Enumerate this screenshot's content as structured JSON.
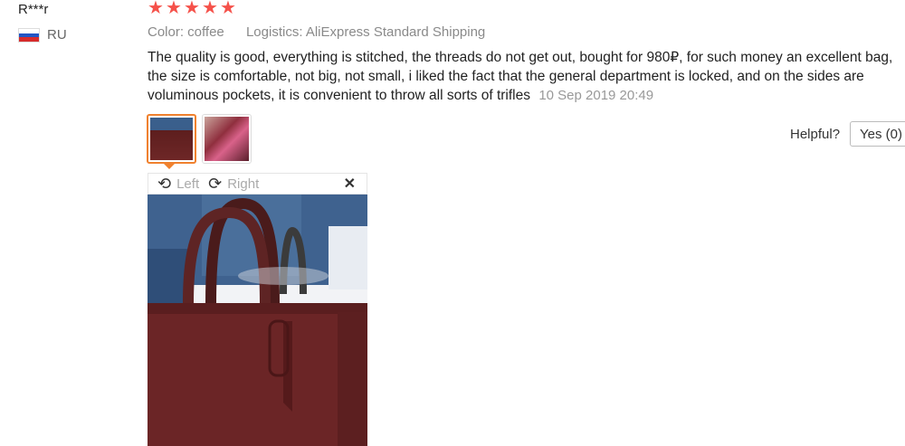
{
  "reviewer": {
    "name": "R***r",
    "country": "RU",
    "flag_icon": "russia-flag-icon"
  },
  "rating": {
    "stars": 5,
    "max": 5,
    "color": "#f5514a"
  },
  "meta": {
    "color": "Color: coffee",
    "logistics": "Logistics: AliExpress Standard Shipping"
  },
  "review": {
    "text": "The quality is good, everything is stitched, the threads do not get out, bought for 980₽, for such money an excellent bag, the size is comfortable, not big, not small, i liked the fact that the general department is locked, and on the sides are voluminous pockets, it is convenient to throw all sorts of trifles",
    "date": "10 Sep 2019 20:49"
  },
  "images": {
    "count": 2,
    "active_index": 0,
    "active_border": "#f0812e"
  },
  "viewer": {
    "rotate_left": "Left",
    "rotate_right": "Right",
    "close_icon": "close-icon"
  },
  "helpful": {
    "label": "Helpful?",
    "yes_button": "Yes (0)"
  }
}
